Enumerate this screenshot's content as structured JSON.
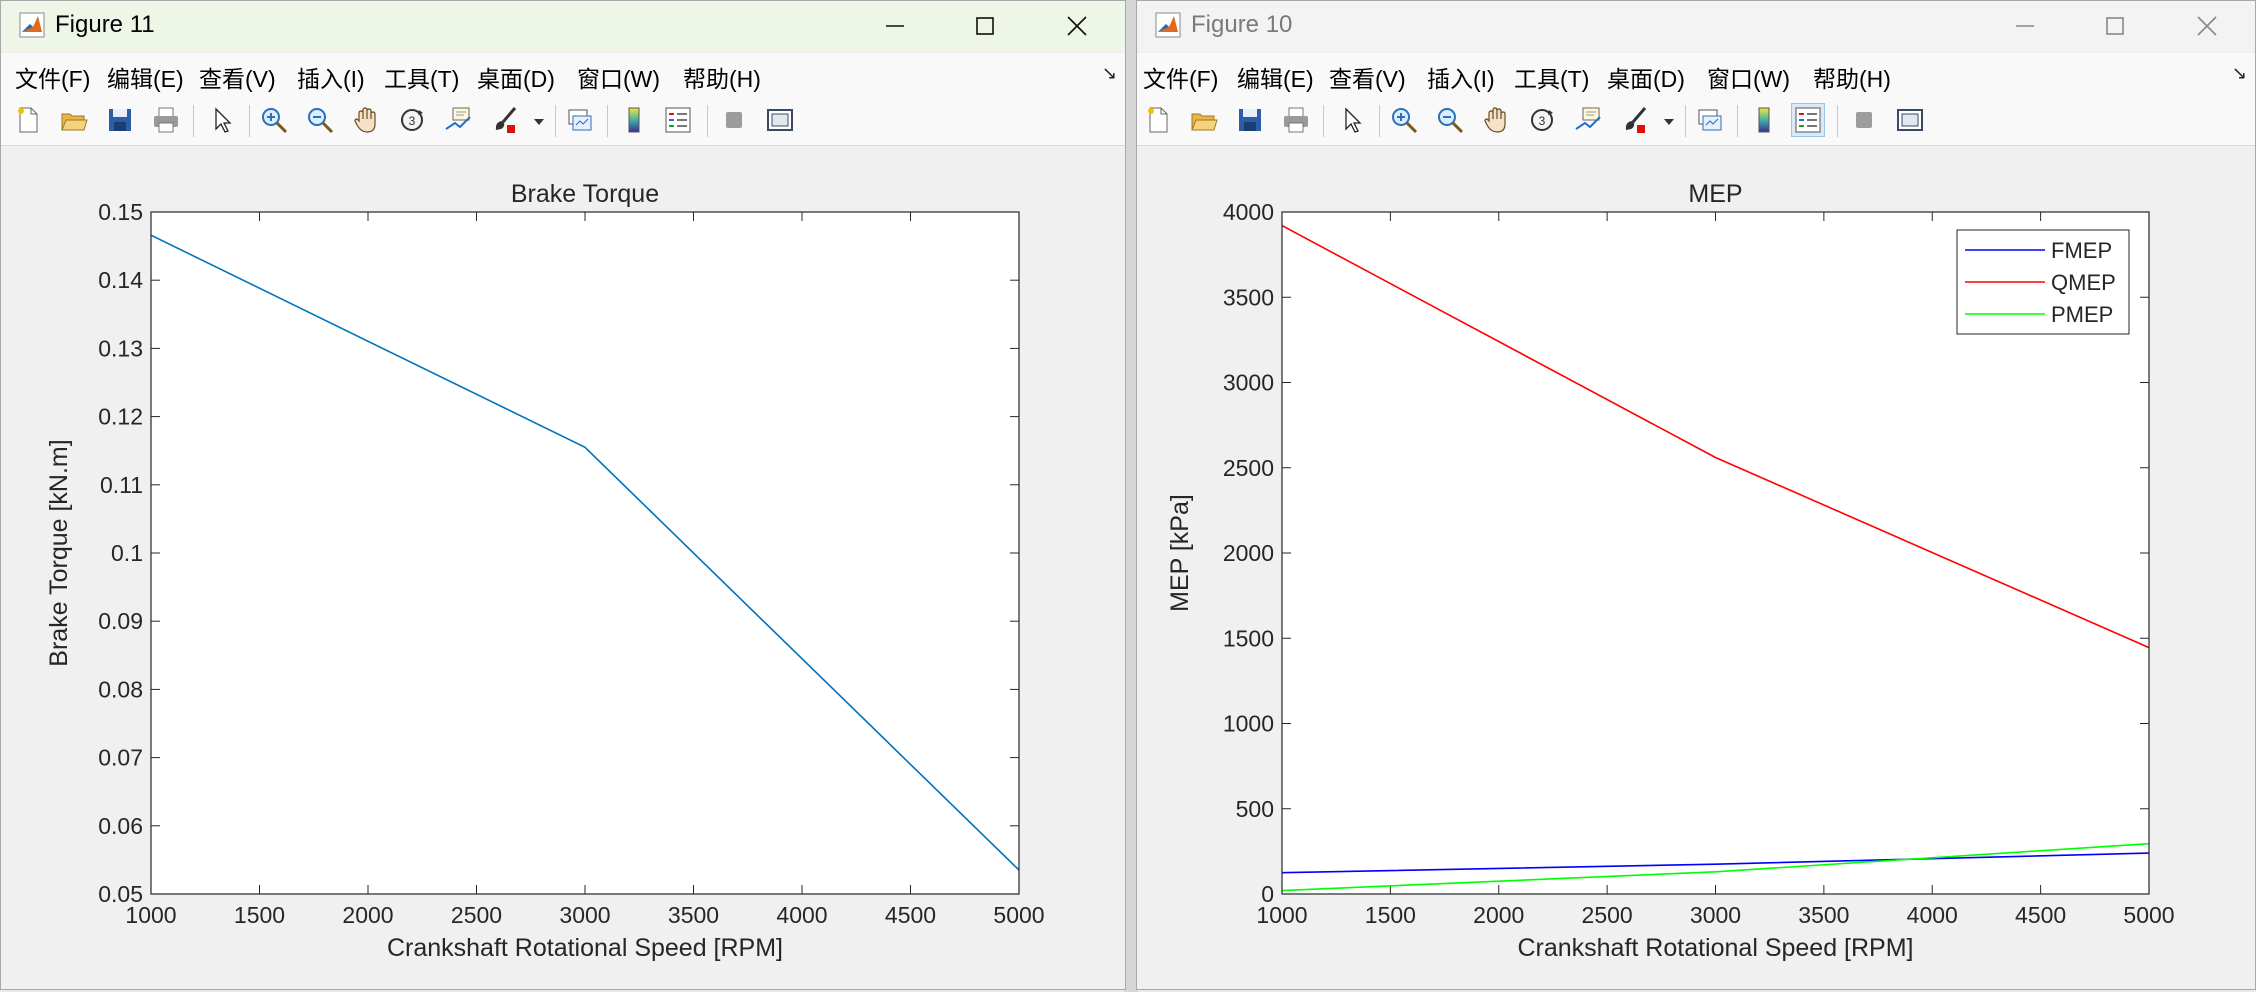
{
  "windows": [
    {
      "id": "left",
      "title": "Figure 11",
      "menu": [
        "文件(F)",
        "编辑(E)",
        "查看(V)",
        "插入(I)",
        "工具(T)",
        "桌面(D)",
        "窗口(W)",
        "帮助(H)"
      ],
      "chart": {
        "title": "Brake Torque",
        "xlabel": "Crankshaft Rotational Speed [RPM]",
        "ylabel": "Brake Torque [kN.m]",
        "xticks": [
          "1000",
          "1500",
          "2000",
          "2500",
          "3000",
          "3500",
          "4000",
          "4500",
          "5000"
        ],
        "yticks": [
          "0.05",
          "0.06",
          "0.07",
          "0.08",
          "0.09",
          "0.1",
          "0.11",
          "0.12",
          "0.13",
          "0.14",
          "0.15"
        ]
      }
    },
    {
      "id": "right",
      "title": "Figure 10",
      "menu": [
        "文件(F)",
        "编辑(E)",
        "查看(V)",
        "插入(I)",
        "工具(T)",
        "桌面(D)",
        "窗口(W)",
        "帮助(H)"
      ],
      "chart": {
        "title": "MEP",
        "xlabel": "Crankshaft Rotational Speed [RPM]",
        "ylabel": "MEP [kPa]",
        "xticks": [
          "1000",
          "1500",
          "2000",
          "2500",
          "3000",
          "3500",
          "4000",
          "4500",
          "5000"
        ],
        "yticks": [
          "0",
          "500",
          "1000",
          "1500",
          "2000",
          "2500",
          "3000",
          "3500",
          "4000"
        ],
        "legend": [
          "FMEP",
          "QMEP",
          "PMEP"
        ]
      }
    }
  ],
  "chart_data": [
    {
      "type": "line",
      "title": "Brake Torque",
      "xlabel": "Crankshaft Rotational Speed [RPM]",
      "ylabel": "Brake Torque [kN.m]",
      "xlim": [
        1000,
        5000
      ],
      "ylim": [
        0.05,
        0.15
      ],
      "grid": false,
      "series": [
        {
          "x": [
            1000,
            3000,
            5000
          ],
          "y": [
            0.1466,
            0.1155,
            0.0535
          ],
          "color": "#0072bd"
        }
      ]
    },
    {
      "type": "line",
      "title": "MEP",
      "xlabel": "Crankshaft Rotational Speed [RPM]",
      "ylabel": "MEP [kPa]",
      "xlim": [
        1000,
        5000
      ],
      "ylim": [
        0,
        4000
      ],
      "grid": false,
      "legend_position": "top-right",
      "series": [
        {
          "name": "FMEP",
          "x": [
            1000,
            3000,
            5000
          ],
          "y": [
            125,
            175,
            240
          ],
          "color": "#0000ff"
        },
        {
          "name": "QMEP",
          "x": [
            1000,
            3000,
            5000
          ],
          "y": [
            3920,
            2560,
            1445
          ],
          "color": "#ff0000"
        },
        {
          "name": "PMEP",
          "x": [
            1000,
            3000,
            5000
          ],
          "y": [
            20,
            130,
            295
          ],
          "color": "#00ff00"
        }
      ]
    }
  ]
}
